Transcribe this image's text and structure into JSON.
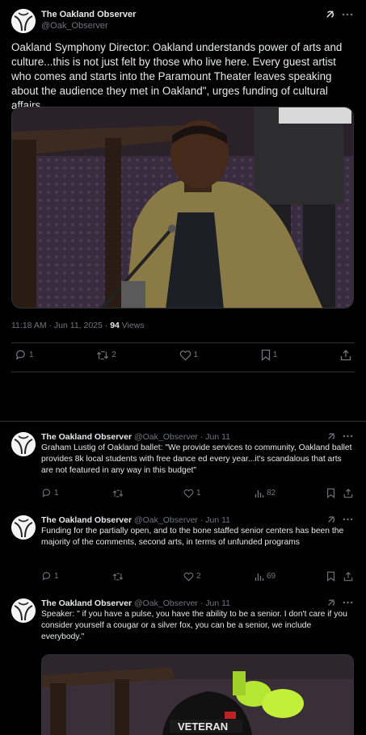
{
  "main_post": {
    "author_name": "The Oakland Observer",
    "author_handle": "@Oak_Observer",
    "text": "Oakland Symphony Director: Oakland understands power of arts and culture...this is not just felt by those who live here. Every guest artist who comes and starts into the Paramount Theater leaves speaking about the audience they met in Oakland\", urges funding of cultural affairs",
    "timestamp": "11:18 AM · Jun 11, 2025 · ",
    "views_count": "94",
    "views_label": " Views",
    "replies": "1",
    "reposts": "2",
    "likes": "1",
    "bookmarks": "1",
    "icons": [
      "grok-icon",
      "more-icon",
      "reply-icon",
      "repost-icon",
      "like-icon",
      "bookmark-icon",
      "share-icon"
    ]
  },
  "replies": [
    {
      "author_name": "The Oakland Observer",
      "author_handle": "@Oak_Observer",
      "date": "· Jun 11",
      "text": "Graham Lustig of Oakland ballet: \"We provide services to community, Oakland ballet provides 8k local students with free dance ed every year...it's scandalous that arts are not featured in any way in this budget\"",
      "reply_count": "1",
      "repost_count": "",
      "like_count": "1",
      "view_count": "82"
    },
    {
      "author_name": "The Oakland Observer",
      "author_handle": "@Oak_Observer",
      "date": "· Jun 11",
      "text": "Funding for the partially open, and to the bone staffed senior centers has been the majority of the comments, second arts, in terms of unfunded programs",
      "reply_count": "1",
      "repost_count": "",
      "like_count": "2",
      "view_count": "69"
    },
    {
      "author_name": "The Oakland Observer",
      "author_handle": "@Oak_Observer",
      "date": "· Jun 11",
      "text": "Speaker: \" if you have a pulse, you have the ability to be a senior. I don't care if you consider yourself a cougar or a silver fox, you can be a senior, we include everybody.\"",
      "media_text": "VETERAN"
    }
  ],
  "colors": {
    "background": "#000000",
    "text": "#e7e9ea",
    "muted": "#71767b",
    "border": "#2f3336"
  }
}
